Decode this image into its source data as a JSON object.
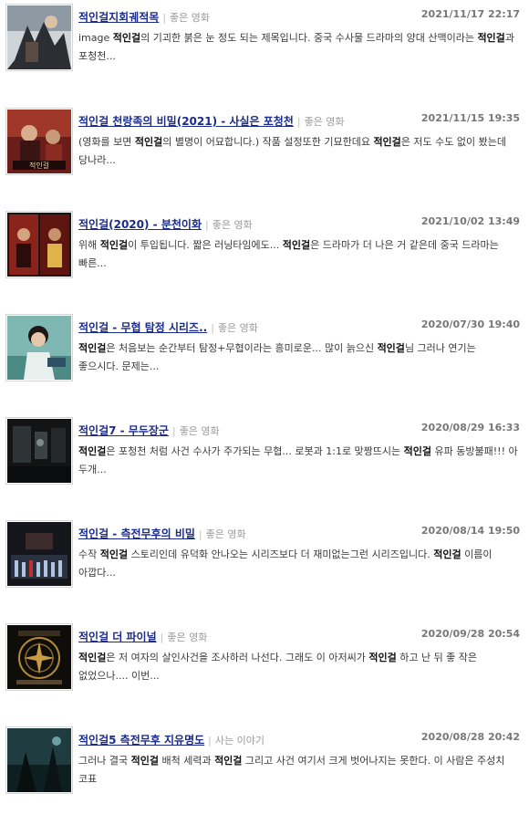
{
  "items": [
    {
      "title": "적인걸지회궤적목",
      "category": "좋은 영화",
      "date": "2021/11/17 22:17",
      "thumb": "movie-poster-thumbnail",
      "snippet": [
        {
          "t": "image ",
          "b": false
        },
        {
          "t": "적인걸",
          "b": true
        },
        {
          "t": "의 기괴한 붉은 눈 정도 되는 제목입니다. 중국 수사물 드라마의 양대 산맥이라는 ",
          "b": false
        },
        {
          "t": "적인걸",
          "b": true
        },
        {
          "t": "과 포청천...",
          "b": false
        }
      ]
    },
    {
      "title": "적인걸 천랑족의 비밀(2021) - 사실은 포청천",
      "category": "좋은 영화",
      "date": "2021/11/15 19:35",
      "thumb": "movie-poster-thumbnail",
      "snippet": [
        {
          "t": "(영화를 보면 ",
          "b": false
        },
        {
          "t": "적인걸",
          "b": true
        },
        {
          "t": "의 별명이 어묘합니다.) 작품 설정또한 기묘한데요 ",
          "b": false
        },
        {
          "t": "적인걸",
          "b": true
        },
        {
          "t": "은 저도 수도 없이 봤는데 당나라...",
          "b": false
        }
      ]
    },
    {
      "title": "적인걸(2020) - 분천이화",
      "category": "좋은 영화",
      "date": "2021/10/02 13:49",
      "thumb": "movie-poster-thumbnail",
      "snippet": [
        {
          "t": "위해 ",
          "b": false
        },
        {
          "t": "적인걸",
          "b": true
        },
        {
          "t": "이 투입됩니다. 짧은 러닝타임에도... ",
          "b": false
        },
        {
          "t": "적인걸",
          "b": true
        },
        {
          "t": "은 드라마가 더 나은 거 같은데 중국 드라마는 빠른...",
          "b": false
        }
      ]
    },
    {
      "title": "적인걸 - 무협 탐정 시리즈..",
      "category": "좋은 영화",
      "date": "2020/07/30 19:40",
      "thumb": "movie-poster-thumbnail",
      "snippet": [
        {
          "t": "적인걸",
          "b": true
        },
        {
          "t": "은 처음보는 순간부터 탐정+무협이라는 흥미로운... 많이 늙으신 ",
          "b": false
        },
        {
          "t": "적인걸",
          "b": true
        },
        {
          "t": "님 그러나 연기는 좋으시다. 문제는...",
          "b": false
        }
      ]
    },
    {
      "title": "적인걸7 - 무두장군",
      "category": "좋은 영화",
      "date": "2020/08/29 16:33",
      "thumb": "movie-poster-thumbnail",
      "snippet": [
        {
          "t": "적인걸",
          "b": true
        },
        {
          "t": "은 포청천 처럼 사건 수사가 주가되는 무협... 로봇과 1:1로 맞짱뜨시는 ",
          "b": false
        },
        {
          "t": "적인걸",
          "b": true
        },
        {
          "t": " 유파 동방불패!!! 아 두개...",
          "b": false
        }
      ]
    },
    {
      "title": "적인걸 - 측전무후의 비밀",
      "category": "좋은 영화",
      "date": "2020/08/14 19:50",
      "thumb": "movie-poster-thumbnail",
      "snippet": [
        {
          "t": "수작 ",
          "b": false
        },
        {
          "t": "적인걸",
          "b": true
        },
        {
          "t": " 스토리인데 유덕화 안나오는 시리즈보다 더 재미없는그런 시리즈입니다. ",
          "b": false
        },
        {
          "t": "적인걸",
          "b": true
        },
        {
          "t": " 이름이 아깝다...",
          "b": false
        }
      ]
    },
    {
      "title": "적인걸 더 파이널",
      "category": "좋은 영화",
      "date": "2020/09/28 20:54",
      "thumb": "movie-poster-thumbnail",
      "snippet": [
        {
          "t": "적인걸",
          "b": true
        },
        {
          "t": "은 저 여자의 살인사건을 조사하러 나선다. 그래도 이 아저씨가 ",
          "b": false
        },
        {
          "t": "적인걸",
          "b": true
        },
        {
          "t": " 하고 난 뒤 좋 작은 없었으나.... 이번...",
          "b": false
        }
      ]
    },
    {
      "title": "적인걸5 측전무후 지유명도",
      "category": "사는 이야기",
      "date": "2020/08/28 20:42",
      "thumb": "movie-poster-thumbnail",
      "snippet": [
        {
          "t": "그러나 결국 ",
          "b": false
        },
        {
          "t": "적인걸",
          "b": true
        },
        {
          "t": " 배척 세력과 ",
          "b": false
        },
        {
          "t": "적인걸",
          "b": true
        },
        {
          "t": " 그리고 사건 여기서 크게 벗어나지는 못한다. 이 사람은 주성치 코표",
          "b": false
        }
      ]
    }
  ]
}
